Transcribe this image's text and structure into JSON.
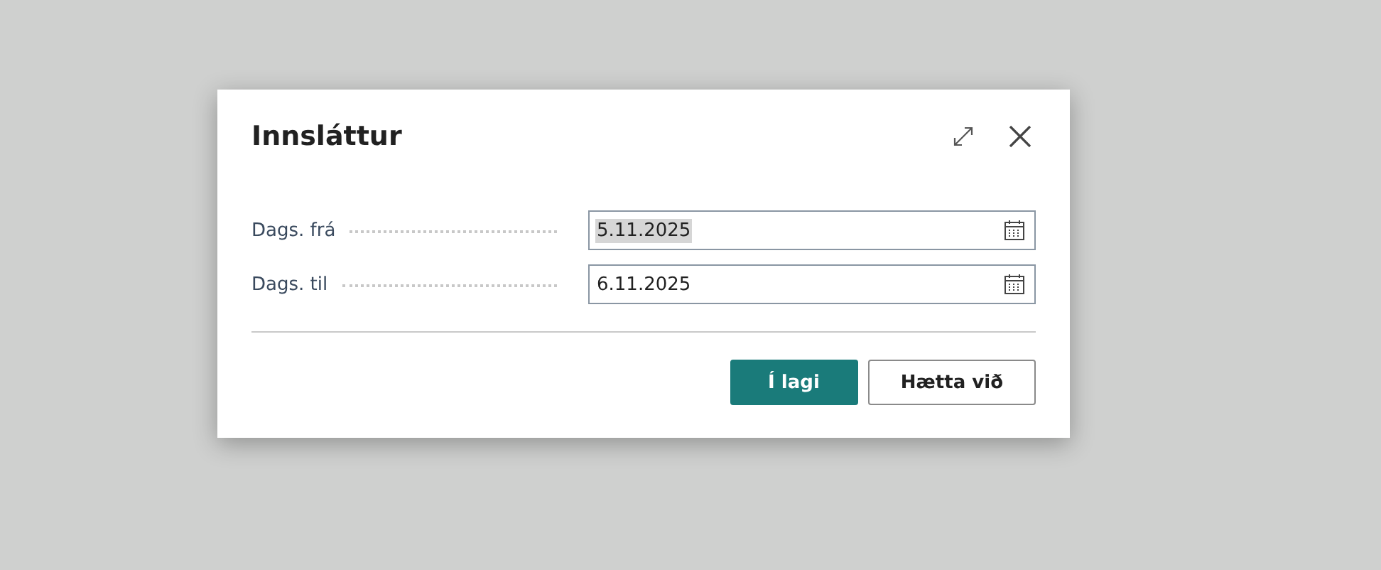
{
  "dialog": {
    "title": "Innsláttur"
  },
  "fields": [
    {
      "label": "Dags. frá",
      "value": "5.11.2025",
      "highlighted": true
    },
    {
      "label": "Dags. til",
      "value": "6.11.2025",
      "highlighted": false
    }
  ],
  "buttons": [
    {
      "label": "Í lagi",
      "kind": "primary"
    },
    {
      "label": "Hætta við",
      "kind": "secondary"
    }
  ]
}
